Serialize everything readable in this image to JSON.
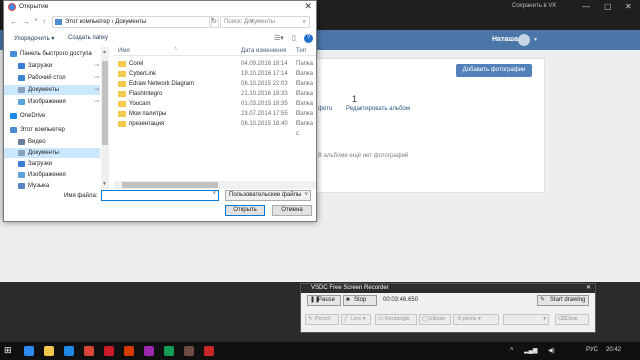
{
  "browser": {
    "tab_text": "Сохранить в VK"
  },
  "vk": {
    "user_name": "Наташа",
    "add_photos": "Добавить фотографии",
    "count": "1",
    "tab_left": "фото",
    "tab_right": "Редактировать альбом",
    "empty": "В альбоме ещё нет фотографий"
  },
  "dialog": {
    "title": "Открытие",
    "address_root": "Этот компьютер",
    "address_sep": "›",
    "address_current": "Документы",
    "search_placeholder": "Поиск: Документы",
    "organize": "Упорядочить ▾",
    "new_folder": "Создать папку",
    "tree": [
      {
        "label": "Панель быстрого доступа",
        "icon": "star-icon",
        "color": "#4a90d9"
      },
      {
        "label": "Загрузки",
        "icon": "downloads-icon",
        "color": "#3a7bd5"
      },
      {
        "label": "Рабочий стол",
        "icon": "desktop-icon",
        "color": "#3a86d4"
      },
      {
        "label": "Документы",
        "icon": "documents-icon",
        "color": "#8aa2bd"
      },
      {
        "label": "Изображения",
        "icon": "pictures-icon",
        "color": "#5ba3d9"
      },
      {
        "label": "OneDrive",
        "icon": "onedrive-icon",
        "color": "#1e88e5"
      },
      {
        "label": "Этот компьютер",
        "icon": "computer-icon",
        "color": "#4c8bd0"
      },
      {
        "label": "Видео",
        "icon": "video-icon",
        "color": "#6a7ea0"
      },
      {
        "label": "Документы",
        "icon": "documents-icon",
        "color": "#8aa2bd"
      },
      {
        "label": "Загрузки",
        "icon": "downloads-icon",
        "color": "#3a7bd5"
      },
      {
        "label": "Изображения",
        "icon": "pictures-icon",
        "color": "#5ba3d9"
      },
      {
        "label": "Музыка",
        "icon": "music-icon",
        "color": "#5a84c4"
      }
    ],
    "columns": {
      "name": "Имя",
      "date": "Дата изменения",
      "type": "Тип"
    },
    "files": [
      {
        "name": "Corel",
        "date": "04.09.2016 18:14",
        "type": "Папка с"
      },
      {
        "name": "CyberLink",
        "date": "19.10.2016 17:14",
        "type": "Папка с"
      },
      {
        "name": "Edraw Network Diagram",
        "date": "06.10.2015 22:03",
        "type": "Папка с"
      },
      {
        "name": "FlashIntegro",
        "date": "21.10.2016 19:33",
        "type": "Папка с"
      },
      {
        "name": "Youcam",
        "date": "01.03.2015 18:35",
        "type": "Папка с"
      },
      {
        "name": "Мои палитры",
        "date": "23.07.2014 17:55",
        "type": "Папка с"
      },
      {
        "name": "презентация",
        "date": "06.10.2015 18:40",
        "type": "Папка с"
      }
    ],
    "filename_label": "Имя файла:",
    "filename_value": "",
    "filetype": "Пользовательские файлы",
    "open": "Открыть",
    "cancel": "Отмена"
  },
  "recorder": {
    "title": "VSDC Free Screen Recorder",
    "pause": "Pause",
    "stop": "Stop",
    "time": "00:03:46.650",
    "start_drawing": "Start drawing",
    "tools": [
      "Pencil",
      "Line",
      "Rectangle",
      "Ellipse",
      "8 pixels",
      "",
      "Clear"
    ]
  },
  "taskbar": {
    "lang": "РУС",
    "clock": "20:42",
    "icons": [
      {
        "name": "ie-icon",
        "color": "#2d89ef"
      },
      {
        "name": "folder-icon",
        "color": "#f2c94c"
      },
      {
        "name": "store-icon",
        "color": "#1e88e5"
      },
      {
        "name": "chrome-icon",
        "color": "#db4437"
      },
      {
        "name": "opera-icon",
        "color": "#cc1b2b"
      },
      {
        "name": "office-icon",
        "color": "#d83b01"
      },
      {
        "name": "media-icon",
        "color": "#9c27b0"
      },
      {
        "name": "chrome-icon",
        "color": "#0f9d58"
      },
      {
        "name": "video-editor-icon",
        "color": "#6d4c41"
      },
      {
        "name": "recorder-icon",
        "color": "#c62828"
      }
    ]
  }
}
